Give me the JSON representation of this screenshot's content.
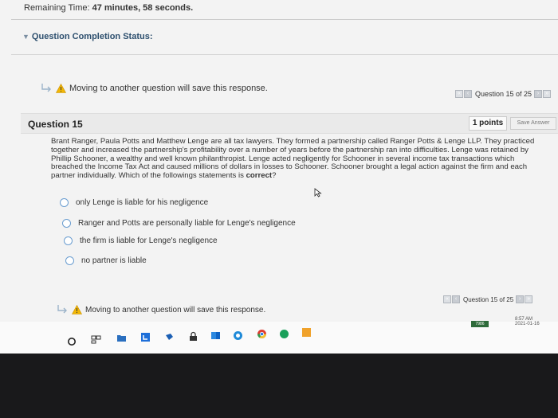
{
  "timer": {
    "label": "Remaining Time:",
    "value": "47 minutes, 58 seconds."
  },
  "completion_status": "Question Completion Status:",
  "warning_text": "Moving to another question will save this response.",
  "nav": {
    "question_label": "Question 15 of 25"
  },
  "question": {
    "title": "Question 15",
    "points": "1 points",
    "save_label": "Save Answer",
    "text_before_bold": "Brant Ranger, Paula Potts and Matthew Lenge are all tax lawyers. They formed a partnership called Ranger Potts & Lenge LLP. They practiced together and increased the partnership's profitability over a number of years before the partnership ran into difficulties. Lenge was retained by Phillip Schooner, a wealthy and well known philanthropist. Lenge acted negligently for Schooner in several income tax transactions which breached the Income Tax Act and caused millions of dollars in losses to Schooner. Schooner brought a legal action against the firm and each partner individually. Which of the followings statements is",
    "text_bold": "correct",
    "text_after_bold": "?",
    "options": [
      "only Lenge is liable for his negligence",
      "Ranger and Potts are personally liable for Lenge's negligence",
      "the firm is liable for Lenge's negligence",
      "no partner is liable"
    ]
  },
  "taskbar": {
    "tray_time": "8:57 AM",
    "tray_date": "2021-01-16",
    "tray_badge": "7986"
  },
  "colors": {
    "page_bg": "#f3f3f3",
    "header_text": "#2d4f6e",
    "radio_border": "#6a9dd0",
    "warning": "#f2b705"
  }
}
